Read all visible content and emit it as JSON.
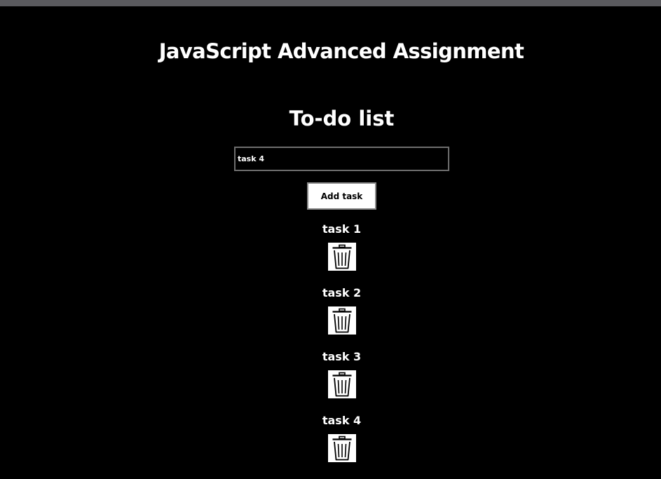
{
  "header": {
    "title": "JavaScript Advanced Assignment"
  },
  "todo": {
    "title": "To-do list",
    "input_value": "task 4",
    "add_label": "Add task",
    "tasks": [
      {
        "label": "task 1",
        "icon": "trash-icon"
      },
      {
        "label": "task 2",
        "icon": "trash-icon"
      },
      {
        "label": "task 3",
        "icon": "trash-icon"
      },
      {
        "label": "task 4",
        "icon": "trash-icon"
      }
    ]
  },
  "colors": {
    "background": "#000000",
    "text": "#ffffff",
    "button_bg": "#ffffff",
    "window_bar": "#5a5a5e"
  }
}
